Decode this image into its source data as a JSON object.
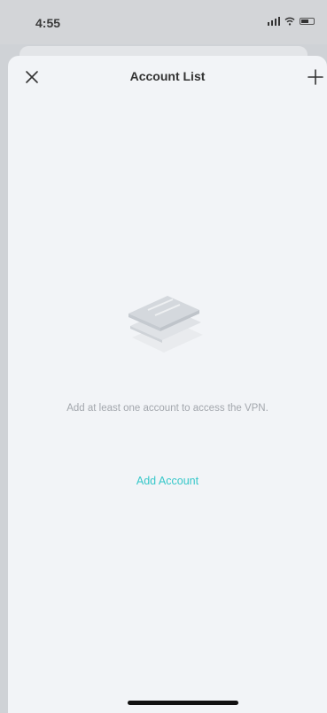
{
  "status_bar": {
    "time": "4:55",
    "icons": [
      "signal-icon",
      "wifi-icon",
      "battery-icon"
    ]
  },
  "header": {
    "title": "Account List",
    "close_icon": "close-icon",
    "add_icon": "plus-icon"
  },
  "empty_state": {
    "illustration": "empty-cards-illustration",
    "message": "Add at least one account to access the VPN.",
    "action_label": "Add Account"
  },
  "colors": {
    "accent": "#35c7c9",
    "background": "#f2f4f7",
    "muted_text": "#a3a7ad",
    "title_text": "#333333"
  }
}
